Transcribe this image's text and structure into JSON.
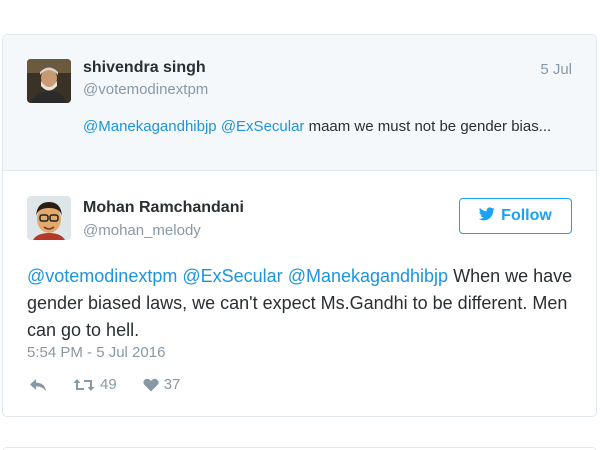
{
  "parent_tweet": {
    "name": "shivendra singh",
    "handle": "@votemodinextpm",
    "date": "5 Jul",
    "mention1": "@Manekagandhibjp",
    "mention2": "@ExSecular",
    "text": " maam we must not be gender bias..."
  },
  "main_tweet": {
    "name": "Mohan Ramchandani",
    "handle": "@mohan_melody",
    "follow_label": "Follow",
    "mention1": "@votemodinextpm",
    "mention2": "@ExSecular",
    "mention3": "@Manekagandhibjp",
    "text": " When we have gender biased laws, we can't expect Ms.Gandhi to be different. Men can go to hell.",
    "timestamp": "5:54 PM - 5 Jul 2016",
    "retweet_count": "49",
    "like_count": "37"
  },
  "icons": {
    "follow": "twitter-bird-icon",
    "reply": "reply-icon",
    "retweet": "retweet-icon",
    "like": "heart-icon"
  },
  "colors": {
    "link": "#1b95e0",
    "accent": "#1da1f2",
    "muted": "#8899a6",
    "text": "#292f33"
  }
}
